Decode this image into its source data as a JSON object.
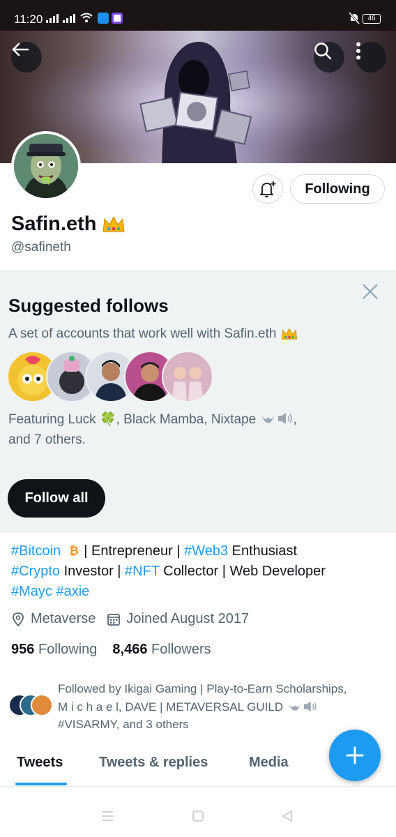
{
  "status_bar": {
    "time": "11:20",
    "battery": "46"
  },
  "profile": {
    "name": "Safin.eth",
    "handle": "@safineth",
    "following_label": "Following"
  },
  "suggested": {
    "title": "Suggested follows",
    "description": "A set of accounts that work well with Safin.eth",
    "featuring_line1": "Featuring Luck 🍀, Black Mamba, Nixtape",
    "featuring_line2": "and 7 others.",
    "follow_all_label": "Follow all"
  },
  "bio": {
    "line1_tag1": "#Bitcoin",
    "line1_rest": " | Entrepreneur | ",
    "line1_tag2": "#Web3",
    "line1_tail": " Enthusiast",
    "line2_tag1": "#Crypto",
    "line2_mid": " Investor | ",
    "line2_tag2": "#NFT",
    "line2_tail": " Collector | Web Developer",
    "line3_tag1": "#Mayc",
    "line3_tag2": "#axie"
  },
  "meta": {
    "location": "Metaverse",
    "joined": "Joined August 2017"
  },
  "counts": {
    "following_count": "956",
    "following_label": "Following",
    "followers_count": "8,466",
    "followers_label": "Followers"
  },
  "followed_by": {
    "line1": "Followed by Ikigai Gaming | Play-to-Earn Scholarships,",
    "line2": "M i c h a e l, DAVE | METAVERSAL GUILD",
    "line3": "#VISARMY, and 3 others"
  },
  "tabs": [
    {
      "label": "Tweets"
    },
    {
      "label": "Tweets & replies"
    },
    {
      "label": "Media"
    }
  ],
  "colors": {
    "accent": "#1d9bf0",
    "text": "#0f1419",
    "secondary": "#536471",
    "suggest_bg": "#eff3f4"
  }
}
